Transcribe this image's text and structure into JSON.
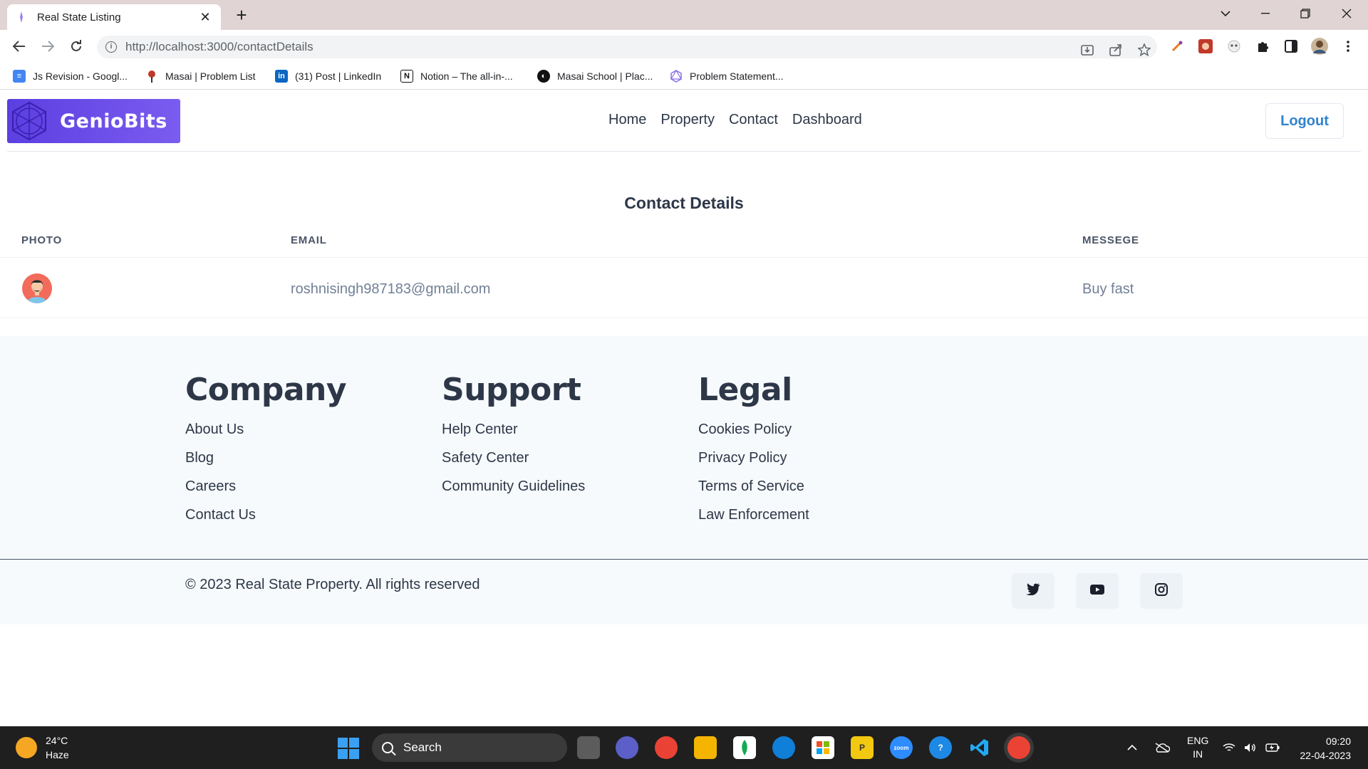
{
  "browser": {
    "tab_title": "Real State Listing",
    "tab_close": "✕",
    "new_tab": "+",
    "url": "http://localhost:3000/contactDetails",
    "bookmarks": [
      {
        "label": "Js Revision - Googl...",
        "icon": "google-docs-icon",
        "color": "#4285f4"
      },
      {
        "label": "Masai | Problem List",
        "icon": "masai-icon",
        "color": "#c0392b"
      },
      {
        "label": "(31) Post | LinkedIn",
        "icon": "linkedin-icon",
        "color": "#0a66c2"
      },
      {
        "label": "Notion – The all-in-...",
        "icon": "notion-icon",
        "color": "#111111"
      },
      {
        "label": "Masai School | Plac...",
        "icon": "masai-school-icon",
        "color": "#111111"
      },
      {
        "label": "Problem Statement...",
        "icon": "graphql-icon",
        "color": "#8a6de9"
      }
    ]
  },
  "site": {
    "logo_text": "GenioBits",
    "nav": [
      {
        "label": "Home"
      },
      {
        "label": "Property"
      },
      {
        "label": "Contact"
      },
      {
        "label": "Dashboard"
      }
    ],
    "logout_label": "Logout",
    "page_title": "Contact Details",
    "table": {
      "headers": [
        "PHOTO",
        "EMAIL",
        "MESSEGE"
      ],
      "rows": [
        {
          "email": "roshnisingh987183@gmail.com",
          "message": "Buy fast"
        }
      ]
    }
  },
  "footer": {
    "columns": [
      {
        "title": "Company",
        "links": [
          "About Us",
          "Blog",
          "Careers",
          "Contact Us"
        ]
      },
      {
        "title": "Support",
        "links": [
          "Help Center",
          "Safety Center",
          "Community Guidelines"
        ]
      },
      {
        "title": "Legal",
        "links": [
          "Cookies Policy",
          "Privacy Policy",
          "Terms of Service",
          "Law Enforcement"
        ]
      }
    ],
    "copyright": "© 2023 Real State Property. All rights reserved",
    "social": [
      "twitter-icon",
      "youtube-icon",
      "instagram-icon"
    ]
  },
  "taskbar": {
    "temperature": "24°C",
    "weather": "Haze",
    "search_label": "Search",
    "language_top": "ENG",
    "language_bottom": "IN",
    "time": "09:20",
    "date": "22-04-2023"
  }
}
